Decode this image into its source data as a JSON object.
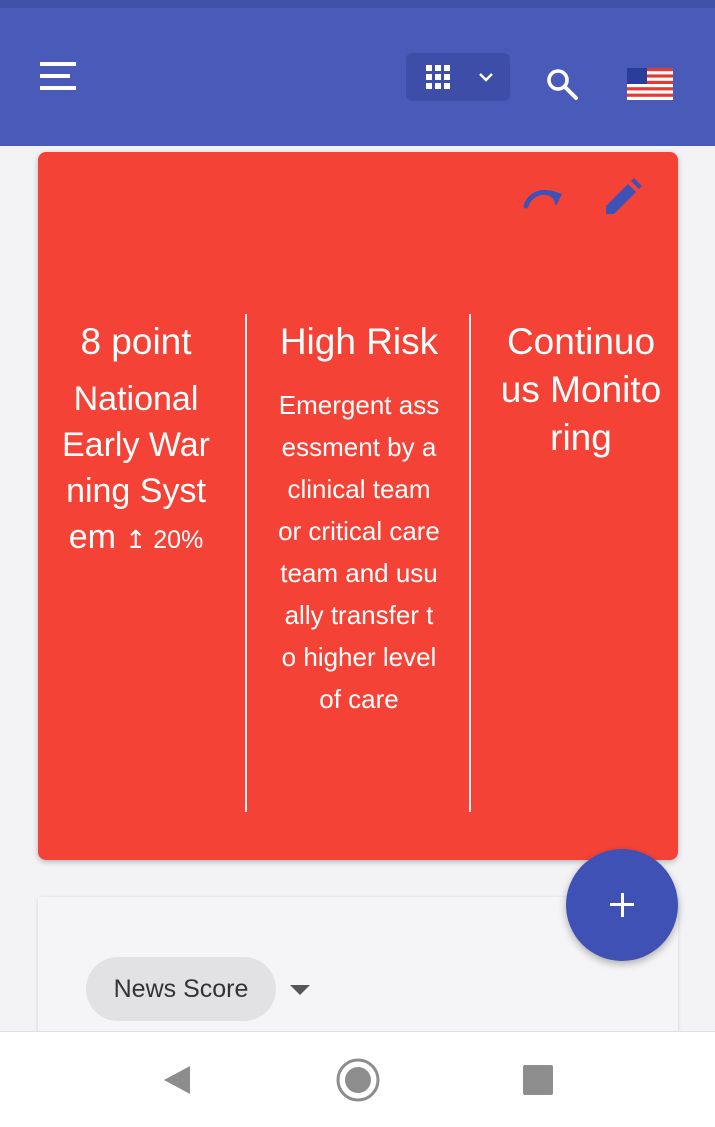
{
  "app": {
    "accent": "#4a5ab9",
    "alert_color": "#f44336",
    "fab_color": "#3f51b5"
  },
  "header": {
    "icons": [
      "menu-icon",
      "apps-grid-icon",
      "chevron-down-icon",
      "search-icon",
      "us-flag-icon"
    ]
  },
  "risk_card": {
    "columns": [
      {
        "title": "8 point",
        "subtitle": "National Early Warning System",
        "trend": "↥ 20%"
      },
      {
        "title": "High Risk",
        "description": "Emergent assessment by a clinical team or critical care team and usually transfer to higher level of care"
      },
      {
        "title": "Continuous Monitoring"
      }
    ],
    "actions": [
      "redo-icon",
      "edit-icon"
    ]
  },
  "fab": {
    "label": "+"
  },
  "score_panel": {
    "chip_label": "News Score"
  },
  "navbar": {
    "icons": [
      "back-icon",
      "home-icon",
      "recents-icon"
    ]
  }
}
